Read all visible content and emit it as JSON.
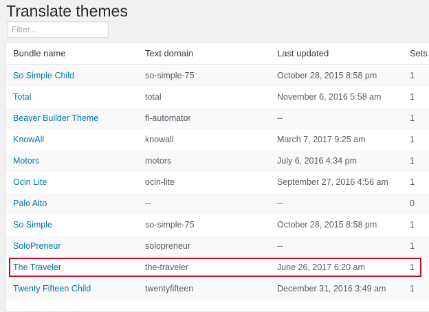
{
  "page": {
    "title": "Translate themes"
  },
  "filter": {
    "placeholder": "Filter..."
  },
  "table": {
    "columns": [
      "Bundle name",
      "Text domain",
      "Last updated",
      "Sets"
    ],
    "rows": [
      {
        "name": "So Simple Child",
        "domain": "so-simple-75",
        "updated": "October 28, 2015 8:58 pm",
        "sets": "1"
      },
      {
        "name": "Total",
        "domain": "total",
        "updated": "November 6, 2016 5:58 am",
        "sets": "1"
      },
      {
        "name": "Beaver Builder Theme",
        "domain": "fl-automator",
        "updated": "--",
        "sets": "1"
      },
      {
        "name": "KnowAll",
        "domain": "knowall",
        "updated": "March 7, 2017 9:25 am",
        "sets": "1"
      },
      {
        "name": "Motors",
        "domain": "motors",
        "updated": "July 6, 2016 4:34 pm",
        "sets": "1"
      },
      {
        "name": "Ocin Lite",
        "domain": "ocin-lite",
        "updated": "September 27, 2016 4:56 am",
        "sets": "1"
      },
      {
        "name": "Palo Alto",
        "domain": "--",
        "updated": "--",
        "sets": "0"
      },
      {
        "name": "So Simple",
        "domain": "so-simple-75",
        "updated": "October 28, 2015 8:58 pm",
        "sets": "1"
      },
      {
        "name": "SoloPreneur",
        "domain": "solopreneur",
        "updated": "--",
        "sets": "1"
      },
      {
        "name": "The Traveler",
        "domain": "the-traveler",
        "updated": "June 26, 2017 6:20 am",
        "sets": "1"
      },
      {
        "name": "Twenty Fifteen Child",
        "domain": "twentyfifteen",
        "updated": "December 31, 2016 3:49 am",
        "sets": "1"
      }
    ]
  },
  "highlight": {
    "color": "#d0021b"
  },
  "colors": {
    "link": "#0073aa",
    "text": "#32373c",
    "page_bg": "#f1f1f1",
    "row_alt": "#f9f9f9"
  }
}
